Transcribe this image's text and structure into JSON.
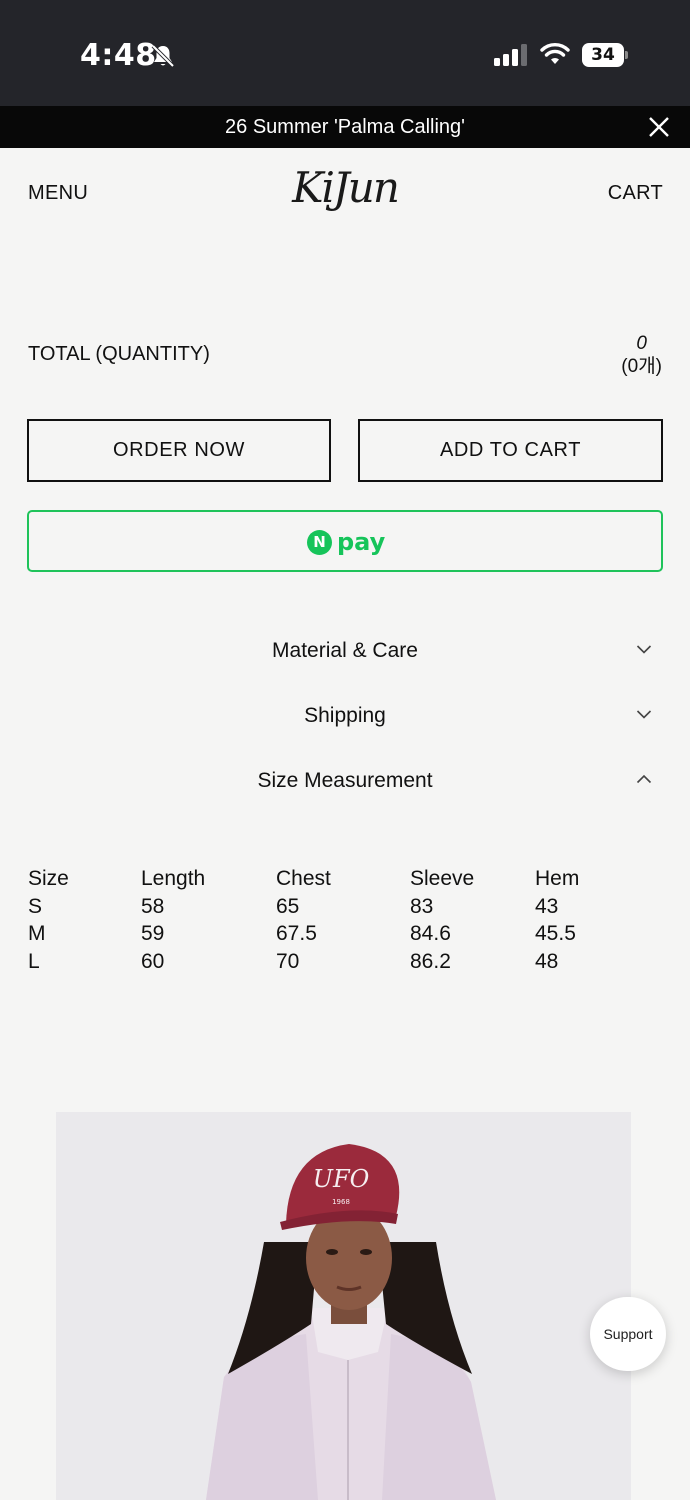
{
  "status_bar": {
    "time": "4:48",
    "battery": "34",
    "icons": [
      "bell-slash-icon",
      "cellular-signal-icon",
      "wifi-icon",
      "battery-icon"
    ]
  },
  "announcement": {
    "text": "26 Summer 'Palma Calling'",
    "close_icon": "close-icon"
  },
  "header": {
    "menu_label": "MENU",
    "logo_text": "KiJun",
    "cart_label": "CART"
  },
  "total": {
    "label": "TOTAL (QUANTITY)",
    "amount": "0",
    "quantity": "(0개)"
  },
  "buttons": {
    "order_now": "ORDER NOW",
    "add_to_cart": "ADD TO CART",
    "npay_mark": "N",
    "npay_text": "pay"
  },
  "accordion": [
    {
      "title": "Material & Care",
      "state": "collapsed",
      "icon": "chevron-down-icon"
    },
    {
      "title": "Shipping",
      "state": "collapsed",
      "icon": "chevron-down-icon"
    },
    {
      "title": "Size Measurement",
      "state": "expanded",
      "icon": "chevron-up-icon"
    }
  ],
  "size_table": {
    "headers": [
      "Size",
      "Length",
      "Chest",
      "Sleeve",
      "Hem"
    ],
    "rows": [
      [
        "S",
        "58",
        "65",
        "83",
        "43"
      ],
      [
        "M",
        "59",
        "67.5",
        "84.6",
        "45.5"
      ],
      [
        "L",
        "60",
        "70",
        "86.2",
        "48"
      ]
    ]
  },
  "product_image": {
    "cap_text": "UFO",
    "cap_small_text": "1968"
  },
  "support": {
    "label": "Support"
  },
  "colors": {
    "status_bar_bg": "#24252a",
    "announcement_bg": "#080808",
    "page_bg": "#f5f5f4",
    "npay_green": "#16c45a",
    "cap_red": "#9b2a3c"
  }
}
